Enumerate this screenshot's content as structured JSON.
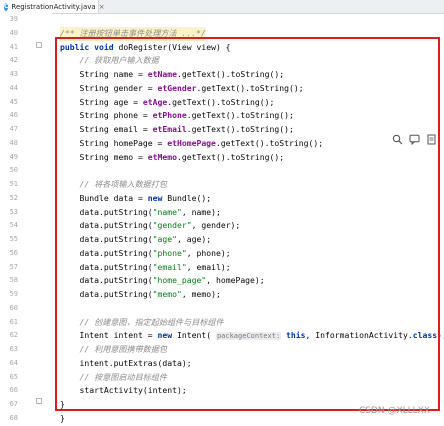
{
  "tab": {
    "icon": "java-class-icon",
    "filename": "RegistrationActivity.java",
    "close": "×"
  },
  "lines": [
    {
      "n": "39",
      "t": [
        [
          "",
          "          "
        ]
      ]
    },
    {
      "n": "40",
      "t": [
        [
          "cmt",
          "/** 注册按钮单击事件处理方法 ...*/"
        ]
      ],
      "hl": true
    },
    {
      "n": "41",
      "t": [
        [
          "kw",
          "public void "
        ],
        [
          "",
          "doRegister(View view) {"
        ]
      ]
    },
    {
      "n": "42",
      "t": [
        [
          "cmt",
          "    // 获取用户输入数据"
        ]
      ]
    },
    {
      "n": "43",
      "t": [
        [
          "",
          "    String name = "
        ],
        [
          "fld",
          "etName"
        ],
        [
          "",
          ".getText().toString();"
        ]
      ]
    },
    {
      "n": "44",
      "t": [
        [
          "",
          "    String gender = "
        ],
        [
          "fld",
          "etGender"
        ],
        [
          "",
          ".getText().toString();"
        ]
      ]
    },
    {
      "n": "45",
      "t": [
        [
          "",
          "    String age = "
        ],
        [
          "fld",
          "etAge"
        ],
        [
          "",
          ".getText().toString();"
        ]
      ]
    },
    {
      "n": "46",
      "t": [
        [
          "",
          "    String phone = "
        ],
        [
          "fld",
          "etPhone"
        ],
        [
          "",
          ".getText().toString();"
        ]
      ]
    },
    {
      "n": "47",
      "t": [
        [
          "",
          "    String email = "
        ],
        [
          "fld",
          "etEmail"
        ],
        [
          "",
          ".getText().toString();"
        ]
      ]
    },
    {
      "n": "48",
      "t": [
        [
          "",
          "    String homePage = "
        ],
        [
          "fld",
          "etHomePage"
        ],
        [
          "",
          ".getText().toString();"
        ]
      ]
    },
    {
      "n": "49",
      "t": [
        [
          "",
          "    String memo = "
        ],
        [
          "fld",
          "etMemo"
        ],
        [
          "",
          ".getText().toString();"
        ]
      ]
    },
    {
      "n": "50",
      "t": [
        [
          "",
          ""
        ]
      ]
    },
    {
      "n": "51",
      "t": [
        [
          "cmt",
          "    // 将各项输入数据打包"
        ]
      ]
    },
    {
      "n": "52",
      "t": [
        [
          "",
          "    Bundle data = "
        ],
        [
          "kw",
          "new "
        ],
        [
          "",
          "Bundle();"
        ]
      ]
    },
    {
      "n": "53",
      "t": [
        [
          "",
          "    data.putString("
        ],
        [
          "str",
          "\"name\""
        ],
        [
          "",
          ", name);"
        ]
      ]
    },
    {
      "n": "54",
      "t": [
        [
          "",
          "    data.putString("
        ],
        [
          "str",
          "\"gender\""
        ],
        [
          "",
          ", gender);"
        ]
      ]
    },
    {
      "n": "55",
      "t": [
        [
          "",
          "    data.putString("
        ],
        [
          "str",
          "\"age\""
        ],
        [
          "",
          ", age);"
        ]
      ]
    },
    {
      "n": "56",
      "t": [
        [
          "",
          "    data.putString("
        ],
        [
          "str",
          "\"phone\""
        ],
        [
          "",
          ", phone);"
        ]
      ]
    },
    {
      "n": "57",
      "t": [
        [
          "",
          "    data.putString("
        ],
        [
          "str",
          "\"email\""
        ],
        [
          "",
          ", email);"
        ]
      ]
    },
    {
      "n": "58",
      "t": [
        [
          "",
          "    data.putString("
        ],
        [
          "str",
          "\"home_page\""
        ],
        [
          "",
          ", homePage);"
        ]
      ]
    },
    {
      "n": "59",
      "t": [
        [
          "",
          "    data.putString("
        ],
        [
          "str",
          "\"memo\""
        ],
        [
          "",
          ", memo);"
        ]
      ]
    },
    {
      "n": "60",
      "t": [
        [
          "",
          ""
        ]
      ]
    },
    {
      "n": "61",
      "t": [
        [
          "cmt",
          "    // 创建意图，指定起始组件与目标组件"
        ]
      ]
    },
    {
      "n": "62",
      "t": [
        [
          "",
          "    Intent intent = "
        ],
        [
          "kw",
          "new "
        ],
        [
          "",
          "Intent( "
        ],
        [
          "hint",
          "packageContext:"
        ],
        [
          "",
          " "
        ],
        [
          "kw",
          "this"
        ],
        [
          "",
          ", InformationActivity."
        ],
        [
          "kw",
          "class"
        ],
        [
          "",
          ");"
        ]
      ]
    },
    {
      "n": "63",
      "t": [
        [
          "cmt",
          "    // 利用意图携带数据包"
        ]
      ]
    },
    {
      "n": "64",
      "t": [
        [
          "",
          "    intent.putExtras(data);"
        ]
      ]
    },
    {
      "n": "65",
      "t": [
        [
          "cmt",
          "    // 按意图启动目标组件"
        ]
      ]
    },
    {
      "n": "66",
      "t": [
        [
          "",
          "    startActivity(intent);"
        ]
      ]
    },
    {
      "n": "67",
      "t": [
        [
          "",
          "}"
        ]
      ]
    },
    {
      "n": "68",
      "t": [
        [
          "",
          "}"
        ]
      ]
    }
  ],
  "float_icons": [
    "magnifier-icon",
    "comment-icon",
    "document-icon"
  ],
  "watermark": "CSDN @XLLLXX"
}
